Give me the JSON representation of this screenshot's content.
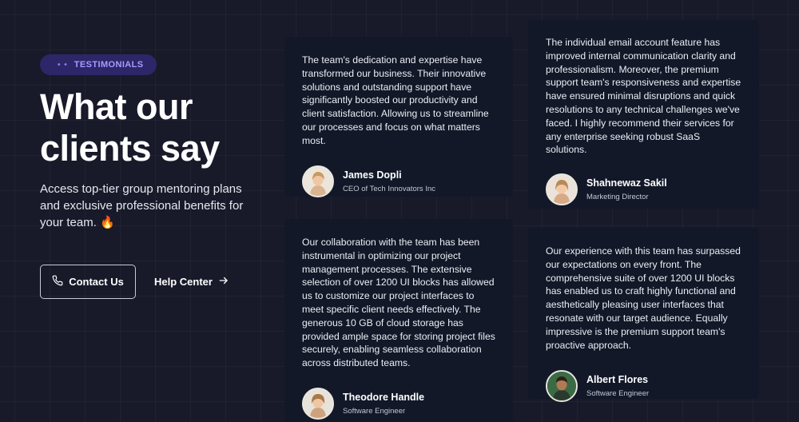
{
  "badge": {
    "label": "TESTIMONIALS",
    "dots": "• •"
  },
  "hero": {
    "title_line1": "What our",
    "title_line2": "clients say",
    "subtitle": "Access top-tier group mentoring plans and exclusive professional benefits for your team. 🔥"
  },
  "actions": {
    "contact_label": "Contact Us",
    "help_label": "Help Center",
    "contact_icon": "phone-icon",
    "help_icon": "arrow-right-icon"
  },
  "colors": {
    "background": "#181a2a",
    "card": "#121828",
    "badge_bg": "#2d2668",
    "badge_text": "#a79bff"
  },
  "testimonials": [
    {
      "quote": "The team's dedication and expertise have transformed our business. Their innovative solutions and outstanding support have significantly boosted our productivity and client satisfaction. Allowing us to streamline our processes and focus on what matters most.",
      "name": "James Dopli",
      "role": "CEO of Tech Innovators Inc"
    },
    {
      "quote": "The individual email account feature has improved internal communication clarity and professionalism. Moreover, the premium support team's responsiveness and expertise have ensured minimal disruptions and quick resolutions to any technical challenges we've faced. I highly recommend their services for any enterprise seeking robust SaaS solutions.",
      "name": "Shahnewaz Sakil",
      "role": "Marketing Director"
    },
    {
      "quote": "Our collaboration with the team has been instrumental in optimizing our project management processes. The extensive selection of over 1200 UI blocks has allowed us to customize our project interfaces to meet specific client needs effectively. The generous 10 GB of cloud storage has provided ample space for storing project files securely, enabling seamless collaboration across distributed teams.",
      "name": "Theodore Handle",
      "role": "Software Engineer"
    },
    {
      "quote": "Our experience with this team has surpassed our expectations on every front. The comprehensive suite of over 1200 UI blocks has enabled us to craft highly functional and aesthetically pleasing user interfaces that resonate with our target audience. Equally impressive is the premium support team's proactive approach.",
      "name": "Albert Flores",
      "role": "Software Engineer"
    }
  ]
}
